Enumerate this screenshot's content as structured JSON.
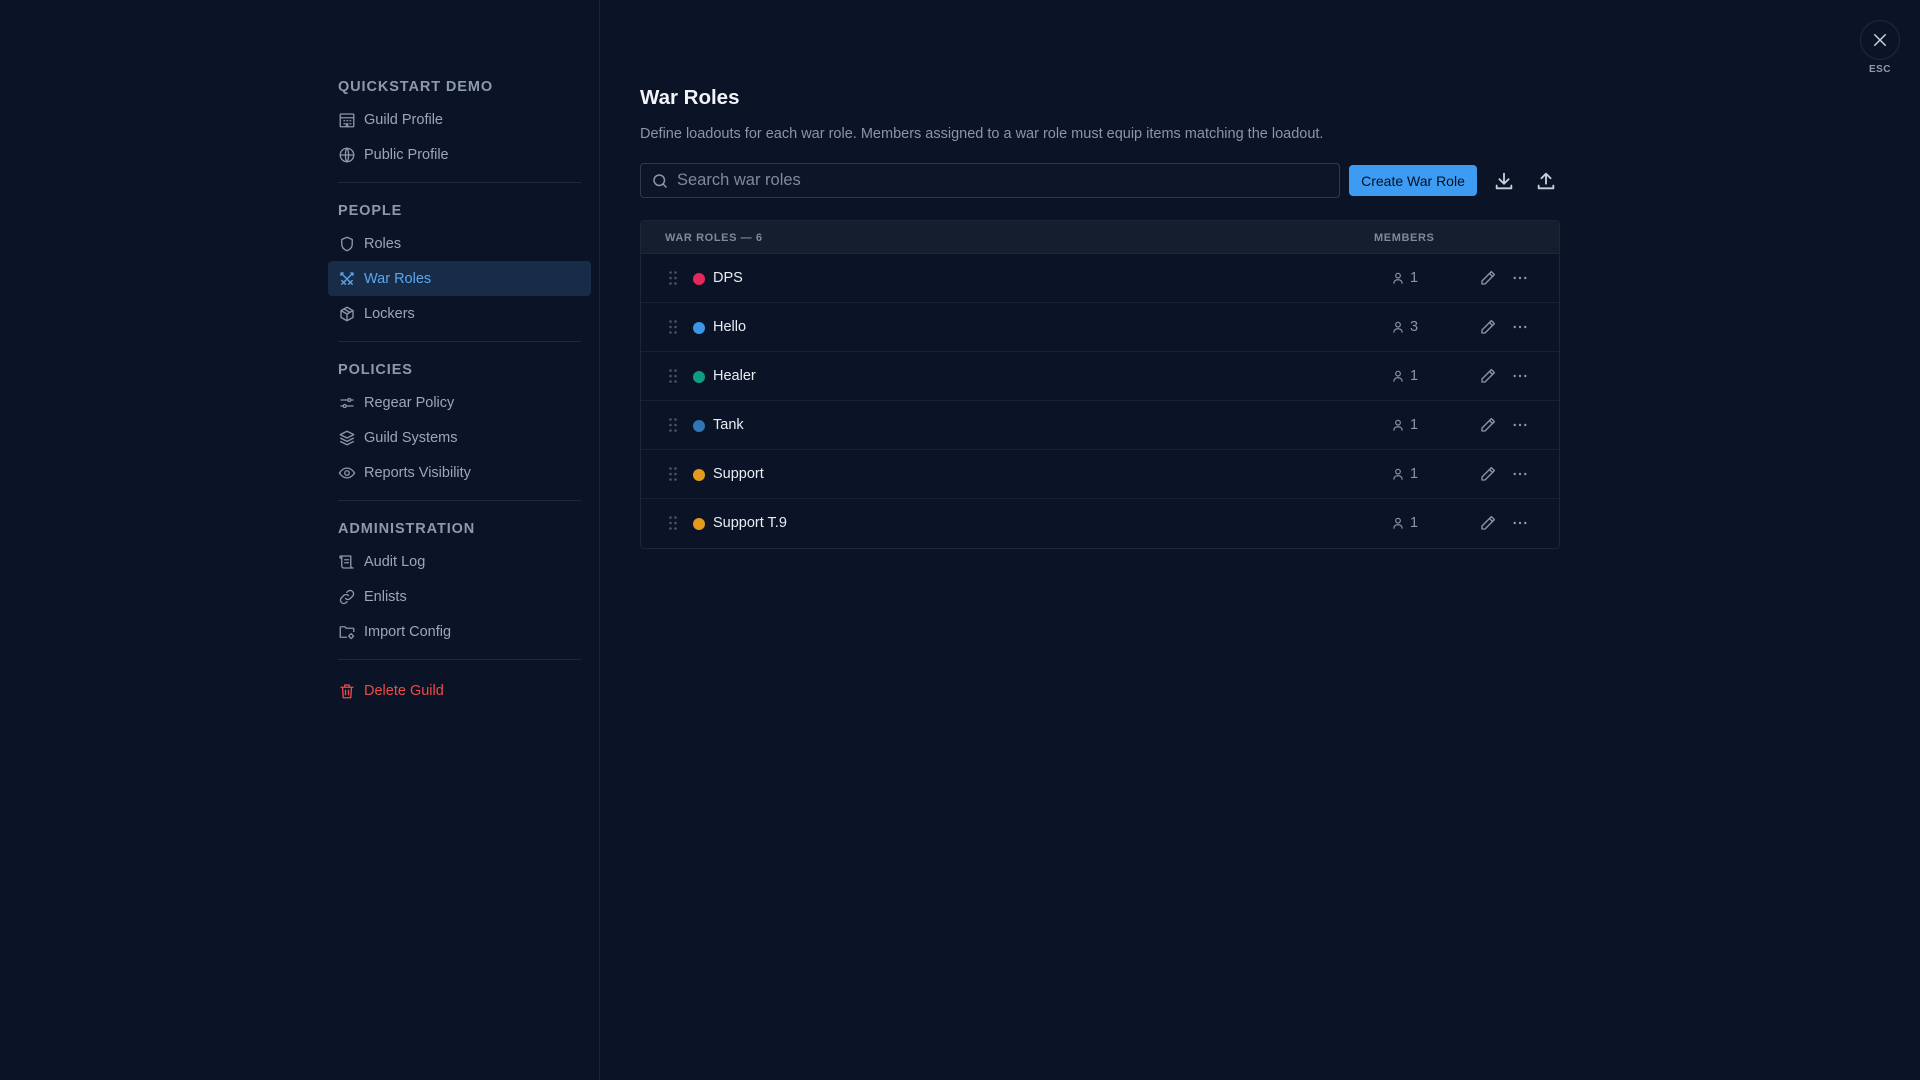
{
  "sidebar": {
    "sections": [
      {
        "title": "QUICKSTART DEMO",
        "items": [
          {
            "label": "Guild Profile",
            "icon": "building-icon"
          },
          {
            "label": "Public Profile",
            "icon": "globe-icon"
          }
        ]
      },
      {
        "title": "PEOPLE",
        "items": [
          {
            "label": "Roles",
            "icon": "shield-icon"
          },
          {
            "label": "War Roles",
            "icon": "crossed-swords-icon",
            "active": true
          },
          {
            "label": "Lockers",
            "icon": "package-icon"
          }
        ]
      },
      {
        "title": "POLICIES",
        "items": [
          {
            "label": "Regear Policy",
            "icon": "sliders-icon"
          },
          {
            "label": "Guild Systems",
            "icon": "layers-icon"
          },
          {
            "label": "Reports Visibility",
            "icon": "eye-icon"
          }
        ]
      },
      {
        "title": "ADMINISTRATION",
        "items": [
          {
            "label": "Audit Log",
            "icon": "scroll-icon"
          },
          {
            "label": "Enlists",
            "icon": "link-icon"
          },
          {
            "label": "Import Config",
            "icon": "folder-cog-icon"
          }
        ]
      }
    ],
    "delete_label": "Delete Guild"
  },
  "main": {
    "title": "War Roles",
    "description": "Define loadouts for each war role. Members assigned to a war role must equip items matching the loadout.",
    "search_placeholder": "Search war roles",
    "create_button": "Create War Role",
    "download_icon": "download-icon",
    "upload_icon": "upload-icon"
  },
  "table": {
    "header_name": "WAR ROLES — 6",
    "header_members": "MEMBERS",
    "rows": [
      {
        "name": "DPS",
        "color": "#e8265c",
        "members": "1"
      },
      {
        "name": "Hello",
        "color": "#3b96e8",
        "members": "3"
      },
      {
        "name": "Healer",
        "color": "#0e9c84",
        "members": "1"
      },
      {
        "name": "Tank",
        "color": "#2e76b6",
        "members": "1"
      },
      {
        "name": "Support",
        "color": "#e69a1c",
        "members": "1"
      },
      {
        "name": "Support T.9",
        "color": "#e69a1c",
        "members": "1"
      }
    ]
  },
  "close": {
    "label": "ESC",
    "icon": "close-icon"
  },
  "colors": {
    "background": "#0b1426",
    "accent": "#3d9bf2",
    "active_nav": "#182c47",
    "danger": "#ef4a4a"
  }
}
